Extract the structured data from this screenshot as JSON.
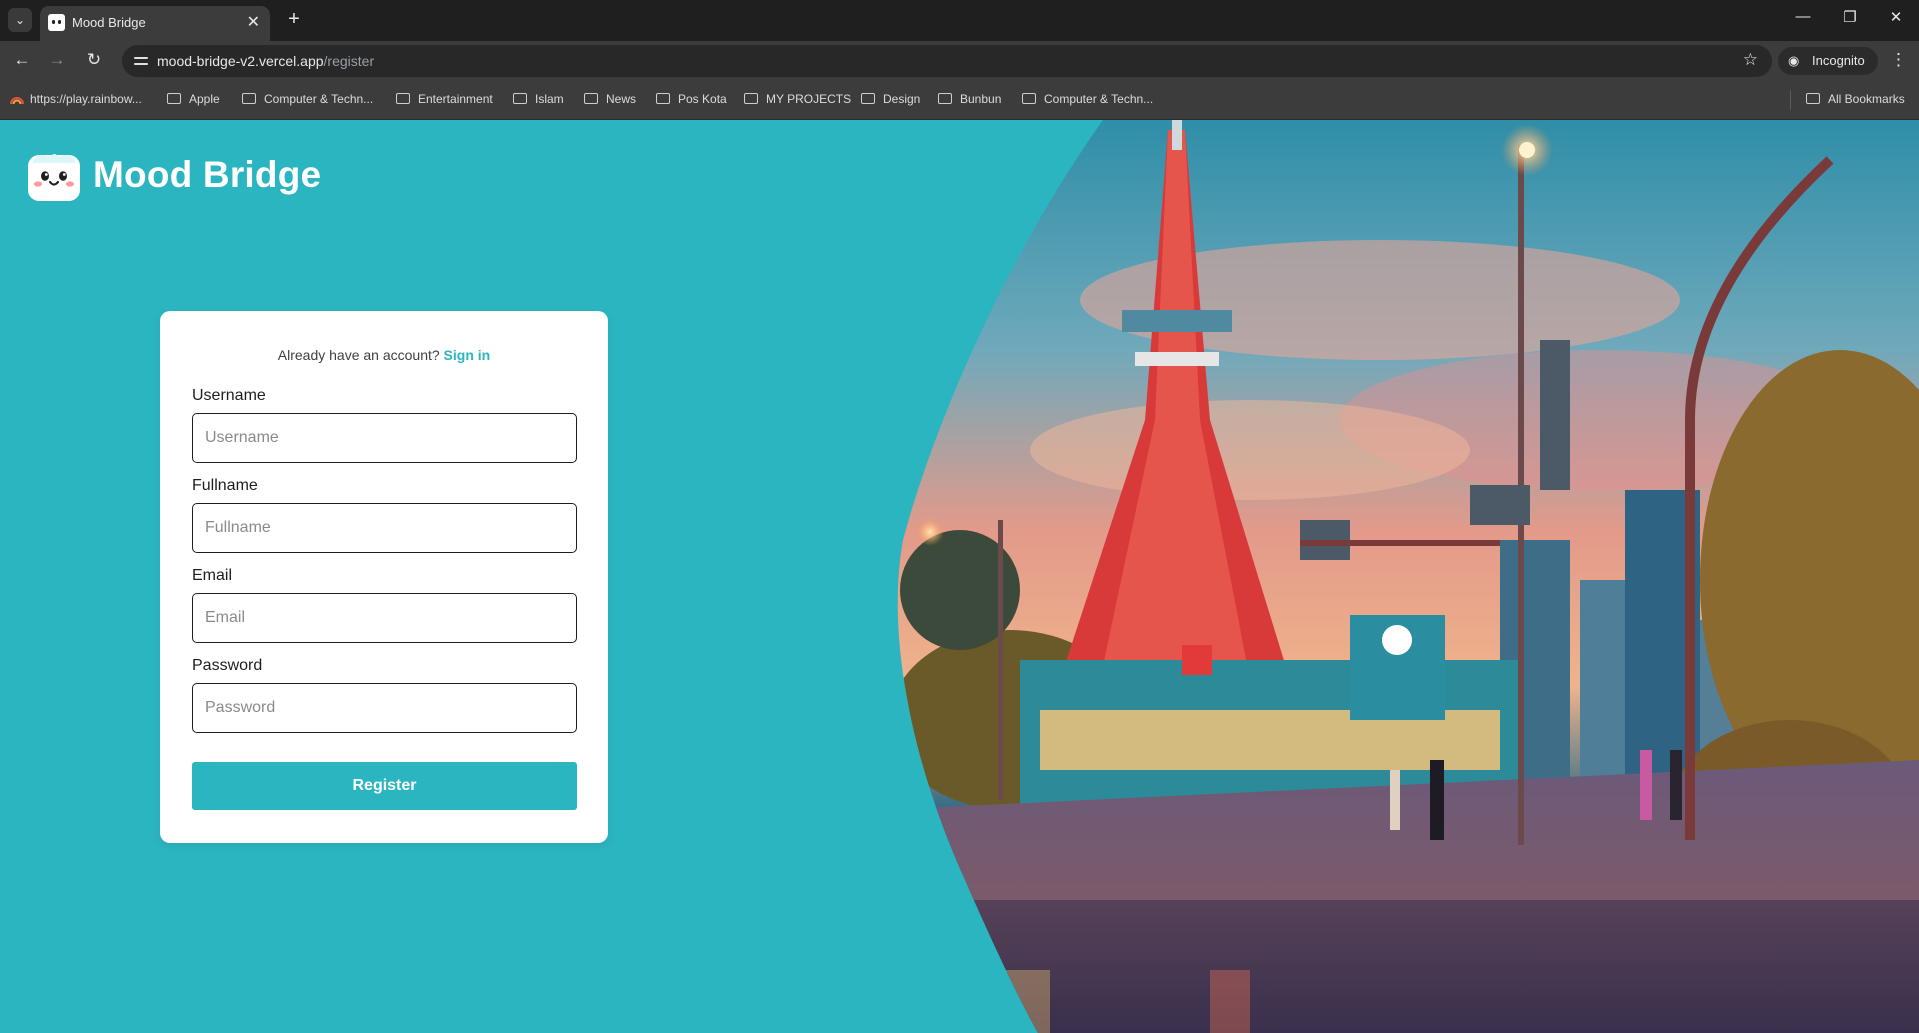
{
  "browser": {
    "tab_title": "Mood Bridge",
    "url_host": "mood-bridge-v2.vercel.app",
    "url_path": "/register",
    "incognito_label": "Incognito",
    "bookmarks": [
      {
        "label": "https://play.rainbow...",
        "icon": "rainbow-favicon"
      },
      {
        "label": "Apple",
        "icon": "folder-icon"
      },
      {
        "label": "Computer & Techn...",
        "icon": "folder-icon"
      },
      {
        "label": "Entertainment",
        "icon": "folder-icon"
      },
      {
        "label": "Islam",
        "icon": "folder-icon"
      },
      {
        "label": "News",
        "icon": "folder-icon"
      },
      {
        "label": "Pos Kota",
        "icon": "folder-icon"
      },
      {
        "label": "MY PROJECTS",
        "icon": "folder-icon"
      },
      {
        "label": "Design",
        "icon": "folder-icon"
      },
      {
        "label": "Bunbun",
        "icon": "folder-icon"
      },
      {
        "label": "Computer & Techn...",
        "icon": "folder-icon"
      }
    ],
    "all_bookmarks_label": "All Bookmarks"
  },
  "app": {
    "brand_name": "Mood Bridge",
    "accent_color": "#2bb5c0"
  },
  "form": {
    "already_text": "Already have an account?",
    "signin_link": "Sign in",
    "fields": [
      {
        "label": "Username",
        "placeholder": "Username",
        "value": ""
      },
      {
        "label": "Fullname",
        "placeholder": "Fullname",
        "value": ""
      },
      {
        "label": "Email",
        "placeholder": "Email",
        "value": ""
      },
      {
        "label": "Password",
        "placeholder": "Password",
        "value": ""
      }
    ],
    "submit_label": "Register"
  }
}
